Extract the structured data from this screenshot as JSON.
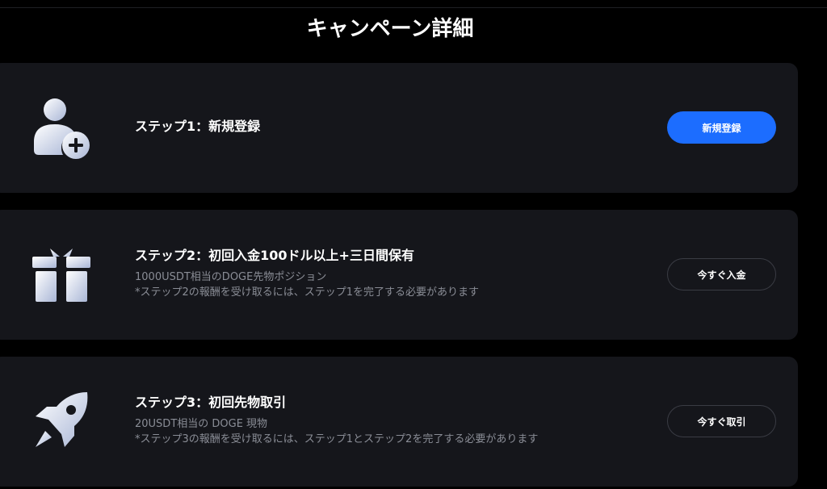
{
  "page": {
    "title": "キャンペーン詳細"
  },
  "steps": [
    {
      "title": "ステップ1：新規登録",
      "button_label": "新規登録",
      "icon": "user-add-icon"
    },
    {
      "title": "ステップ2：初回入金100ドル以上+三日間保有",
      "desc": [
        "1000USDT相当のDOGE先物ポジション",
        "*ステップ2の報酬を受け取るには、ステップ1を完了する必要があります"
      ],
      "button_label": "今すぐ入金",
      "icon": "gift-icon"
    },
    {
      "title": "ステップ3：初回先物取引",
      "desc": [
        "20USDT相当の DOGE 現物",
        "*ステップ3の報酬を受け取るには、ステップ1とステップ2を完了する必要があります"
      ],
      "button_label": "今すぐ取引",
      "icon": "rocket-icon"
    }
  ],
  "colors": {
    "background": "#000000",
    "card": "#15161b",
    "primary_button": "#1c6dff",
    "muted_text": "#8a8d96"
  }
}
